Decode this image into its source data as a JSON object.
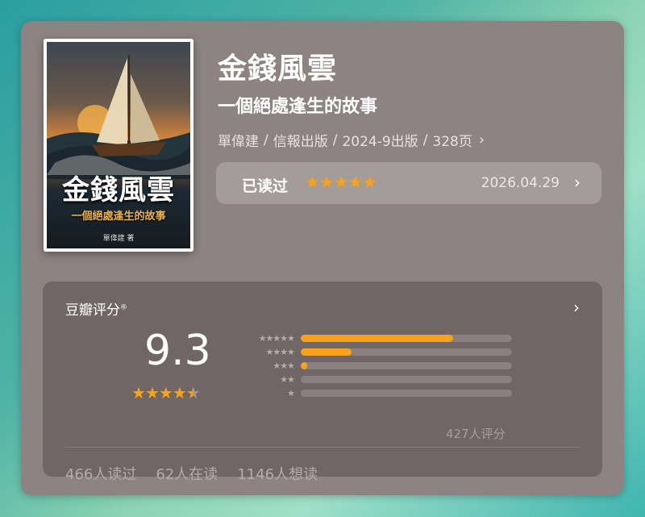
{
  "book": {
    "title": "金錢風雲",
    "subtitle": "一個絕處逢生的故事",
    "meta": {
      "author": "單偉建",
      "publisher": "信報出版",
      "date": "2024-9出版",
      "pages": "328页"
    },
    "cover": {
      "title": "金錢風雲",
      "subtitle": "一個絕處逢生的故事",
      "author": "單偉建 著"
    }
  },
  "read_status": {
    "label": "已读过",
    "stars": "★★★★★",
    "date": "2026.04.29"
  },
  "rating": {
    "title": "豆瓣评分",
    "mark": "®",
    "score": "9.3",
    "stars_value": 4.5,
    "distribution": [
      {
        "stars": "★★★★★",
        "fraction": 0.72
      },
      {
        "stars": "★★★★",
        "fraction": 0.24
      },
      {
        "stars": "★★★",
        "fraction": 0.03
      },
      {
        "stars": "★★",
        "fraction": 0.0
      },
      {
        "stars": "★",
        "fraction": 0.0
      }
    ],
    "count": "427人评分"
  },
  "stats": {
    "read": "466人读过",
    "reading": "62人在读",
    "want": "1146人想读"
  },
  "colors": {
    "accent": "#f7a21b",
    "card": "#8d8382",
    "panel": "#706665"
  }
}
